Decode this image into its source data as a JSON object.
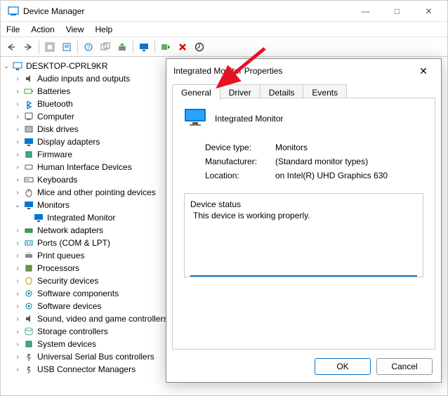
{
  "window": {
    "title": "Device Manager",
    "controls": {
      "min": "—",
      "max": "□",
      "close": "✕"
    }
  },
  "menu": [
    "File",
    "Action",
    "View",
    "Help"
  ],
  "tree": {
    "root": "DESKTOP-CPRL9KR",
    "nodes": [
      {
        "label": "Audio inputs and outputs",
        "exp": ">",
        "icon": "audio"
      },
      {
        "label": "Batteries",
        "exp": ">",
        "icon": "battery"
      },
      {
        "label": "Bluetooth",
        "exp": ">",
        "icon": "bt"
      },
      {
        "label": "Computer",
        "exp": ">",
        "icon": "pc"
      },
      {
        "label": "Disk drives",
        "exp": ">",
        "icon": "disk"
      },
      {
        "label": "Display adapters",
        "exp": ">",
        "icon": "display"
      },
      {
        "label": "Firmware",
        "exp": ">",
        "icon": "chip"
      },
      {
        "label": "Human Interface Devices",
        "exp": ">",
        "icon": "hid"
      },
      {
        "label": "Keyboards",
        "exp": ">",
        "icon": "kb"
      },
      {
        "label": "Mice and other pointing devices",
        "exp": ">",
        "icon": "mouse"
      },
      {
        "label": "Monitors",
        "exp": "v",
        "icon": "monitor",
        "children": [
          {
            "label": "Integrated Monitor",
            "icon": "monitor"
          }
        ]
      },
      {
        "label": "Network adapters",
        "exp": ">",
        "icon": "net"
      },
      {
        "label": "Ports (COM & LPT)",
        "exp": ">",
        "icon": "port"
      },
      {
        "label": "Print queues",
        "exp": ">",
        "icon": "print"
      },
      {
        "label": "Processors",
        "exp": ">",
        "icon": "cpu"
      },
      {
        "label": "Security devices",
        "exp": ">",
        "icon": "sec"
      },
      {
        "label": "Software components",
        "exp": ">",
        "icon": "sw"
      },
      {
        "label": "Software devices",
        "exp": ">",
        "icon": "sw"
      },
      {
        "label": "Sound, video and game controllers",
        "exp": ">",
        "icon": "audio"
      },
      {
        "label": "Storage controllers",
        "exp": ">",
        "icon": "storage"
      },
      {
        "label": "System devices",
        "exp": ">",
        "icon": "chip"
      },
      {
        "label": "Universal Serial Bus controllers",
        "exp": ">",
        "icon": "usb"
      },
      {
        "label": "USB Connector Managers",
        "exp": ">",
        "icon": "usb"
      }
    ]
  },
  "dialog": {
    "title": "Integrated Monitor Properties",
    "tabs": [
      "General",
      "Driver",
      "Details",
      "Events"
    ],
    "activeTab": "General",
    "deviceName": "Integrated Monitor",
    "rows": {
      "type_k": "Device type:",
      "type_v": "Monitors",
      "manu_k": "Manufacturer:",
      "manu_v": "(Standard monitor types)",
      "loc_k": "Location:",
      "loc_v": "on Intel(R) UHD Graphics 630"
    },
    "statusLabel": "Device status",
    "statusText": "This device is working properly.",
    "ok": "OK",
    "cancel": "Cancel"
  }
}
